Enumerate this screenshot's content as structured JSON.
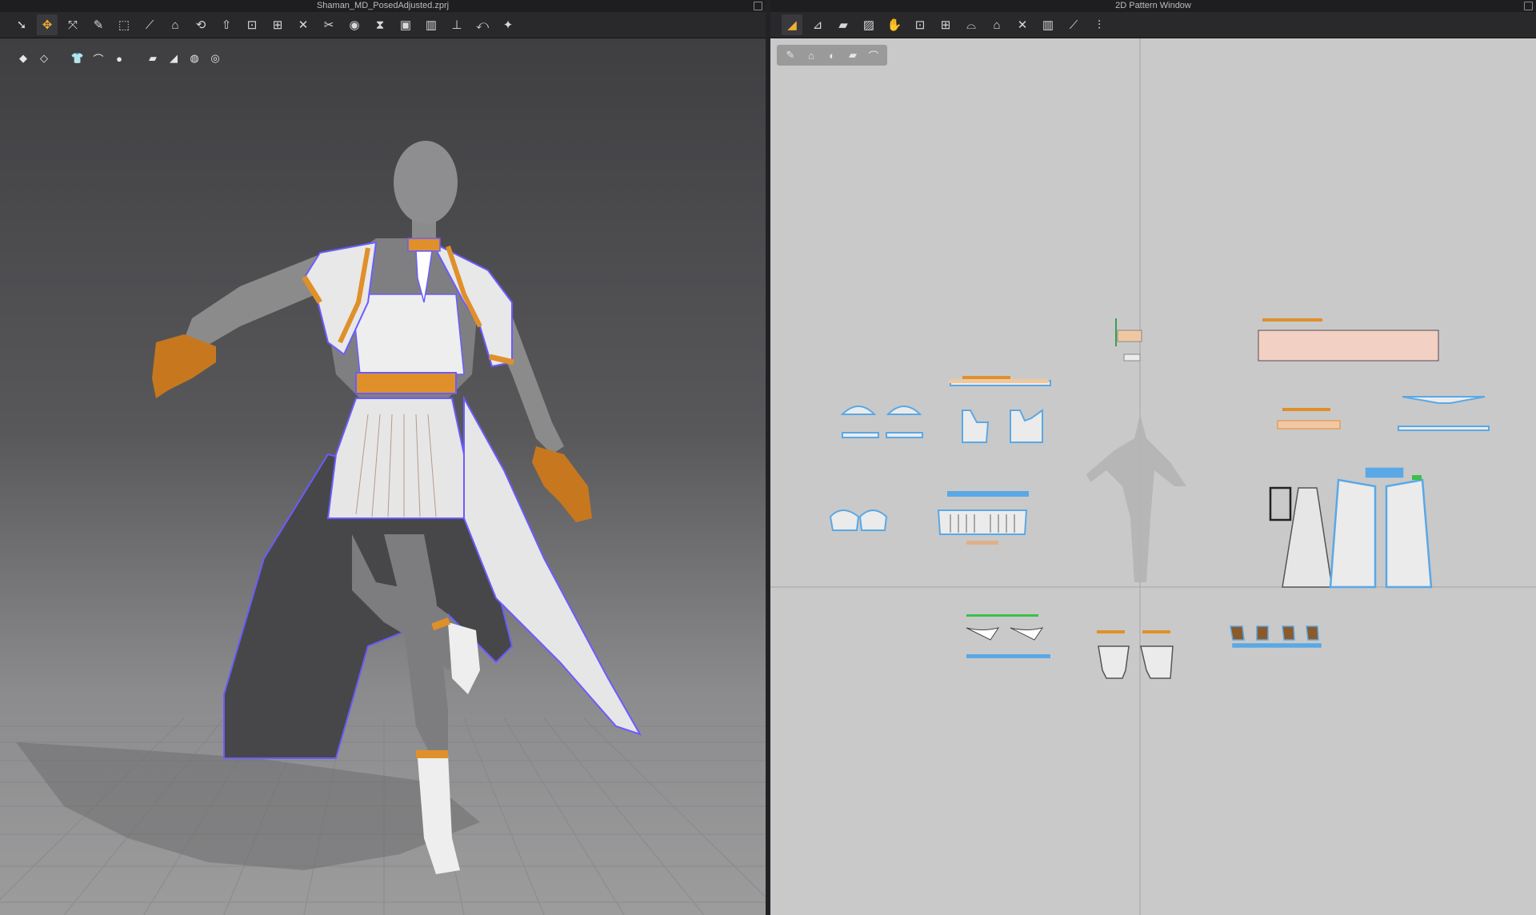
{
  "left_window": {
    "title": "Shaman_MD_PosedAdjusted.zprj",
    "toolbar": [
      {
        "icon": "select-arrow-icon",
        "active": false,
        "glyph": "➘"
      },
      {
        "icon": "move-icon",
        "active": true,
        "glyph": "✥"
      },
      {
        "icon": "select-mesh-icon",
        "active": false,
        "glyph": "⤧"
      },
      {
        "icon": "brush-icon",
        "active": false,
        "glyph": "✎"
      },
      {
        "icon": "box-select-icon",
        "active": false,
        "glyph": "⬚"
      },
      {
        "icon": "line-tool-icon",
        "active": false,
        "glyph": "⟋"
      },
      {
        "icon": "garment-icon",
        "active": false,
        "glyph": "⌂"
      },
      {
        "icon": "fold-icon",
        "active": false,
        "glyph": "⟲"
      },
      {
        "icon": "pin-icon",
        "active": false,
        "glyph": "⇧"
      },
      {
        "icon": "seam-icon",
        "active": false,
        "glyph": "⊡"
      },
      {
        "icon": "grid-icon",
        "active": false,
        "glyph": "⊞"
      },
      {
        "icon": "tack-icon",
        "active": false,
        "glyph": "✕"
      },
      {
        "icon": "cut-icon",
        "active": false,
        "glyph": "✂"
      },
      {
        "icon": "button-icon",
        "active": false,
        "glyph": "◉"
      },
      {
        "icon": "zipper-icon",
        "active": false,
        "glyph": "⧗"
      },
      {
        "icon": "fabric-icon",
        "active": false,
        "glyph": "▣"
      },
      {
        "icon": "puckering-icon",
        "active": false,
        "glyph": "▥"
      },
      {
        "icon": "measure-icon",
        "active": false,
        "glyph": "⊥"
      },
      {
        "icon": "tape-icon",
        "active": false,
        "glyph": "⤺"
      },
      {
        "icon": "avatar-pose-icon",
        "active": false,
        "glyph": "✦"
      }
    ],
    "viewport_tools": [
      {
        "icon": "shaded-view-icon",
        "glyph": "◆"
      },
      {
        "icon": "wire-view-icon",
        "glyph": "◇"
      },
      {
        "sep": true
      },
      {
        "icon": "garment-toggle-icon",
        "glyph": "👕"
      },
      {
        "icon": "hanger-icon",
        "glyph": "⌒"
      },
      {
        "icon": "avatar-toggle-icon",
        "glyph": "●"
      },
      {
        "sep": true
      },
      {
        "icon": "texture-icon",
        "glyph": "▰"
      },
      {
        "icon": "strain-map-icon",
        "glyph": "◢"
      },
      {
        "icon": "light-icon",
        "glyph": "◍"
      },
      {
        "icon": "environment-icon",
        "glyph": "◎"
      }
    ]
  },
  "right_window": {
    "title": "2D Pattern Window",
    "toolbar": [
      {
        "icon": "transform-pattern-icon",
        "active": true,
        "glyph": "◢"
      },
      {
        "icon": "edit-pattern-icon",
        "active": false,
        "glyph": "⊿"
      },
      {
        "icon": "polygon-icon",
        "active": false,
        "glyph": "▰"
      },
      {
        "icon": "rectangle-icon",
        "active": false,
        "glyph": "▨"
      },
      {
        "icon": "internal-line-icon",
        "active": false,
        "glyph": "✋"
      },
      {
        "icon": "dart-icon",
        "active": false,
        "glyph": "⊡"
      },
      {
        "icon": "fold-arrange-icon",
        "active": false,
        "glyph": "⊞"
      },
      {
        "icon": "segment-sewing-icon",
        "active": false,
        "glyph": "⌓"
      },
      {
        "icon": "free-sewing-icon",
        "active": false,
        "glyph": "⌂"
      },
      {
        "icon": "tuck-icon",
        "active": false,
        "glyph": "✕"
      },
      {
        "icon": "pleat-icon",
        "active": false,
        "glyph": "▥"
      },
      {
        "icon": "topstitch-icon",
        "active": false,
        "glyph": "⟋"
      },
      {
        "icon": "ruler-icon",
        "active": false,
        "glyph": "⫶"
      }
    ],
    "pattern_tools": [
      {
        "icon": "pencil-icon",
        "glyph": "✎"
      },
      {
        "icon": "pattern-garment-icon",
        "glyph": "⌂"
      },
      {
        "icon": "info-icon",
        "glyph": "◐"
      },
      {
        "icon": "texture-swatch-icon",
        "glyph": "▰"
      },
      {
        "icon": "hanger-swatch-icon",
        "glyph": "⌒"
      }
    ]
  },
  "colors": {
    "accent_orange": "#e0902a",
    "selection_blue": "#6a5cff",
    "pattern_outline": "#5aa8e6",
    "fabric_white": "#e8e8e8",
    "glove_orange": "#c7781e",
    "skin_gray": "#8b8b8b"
  }
}
